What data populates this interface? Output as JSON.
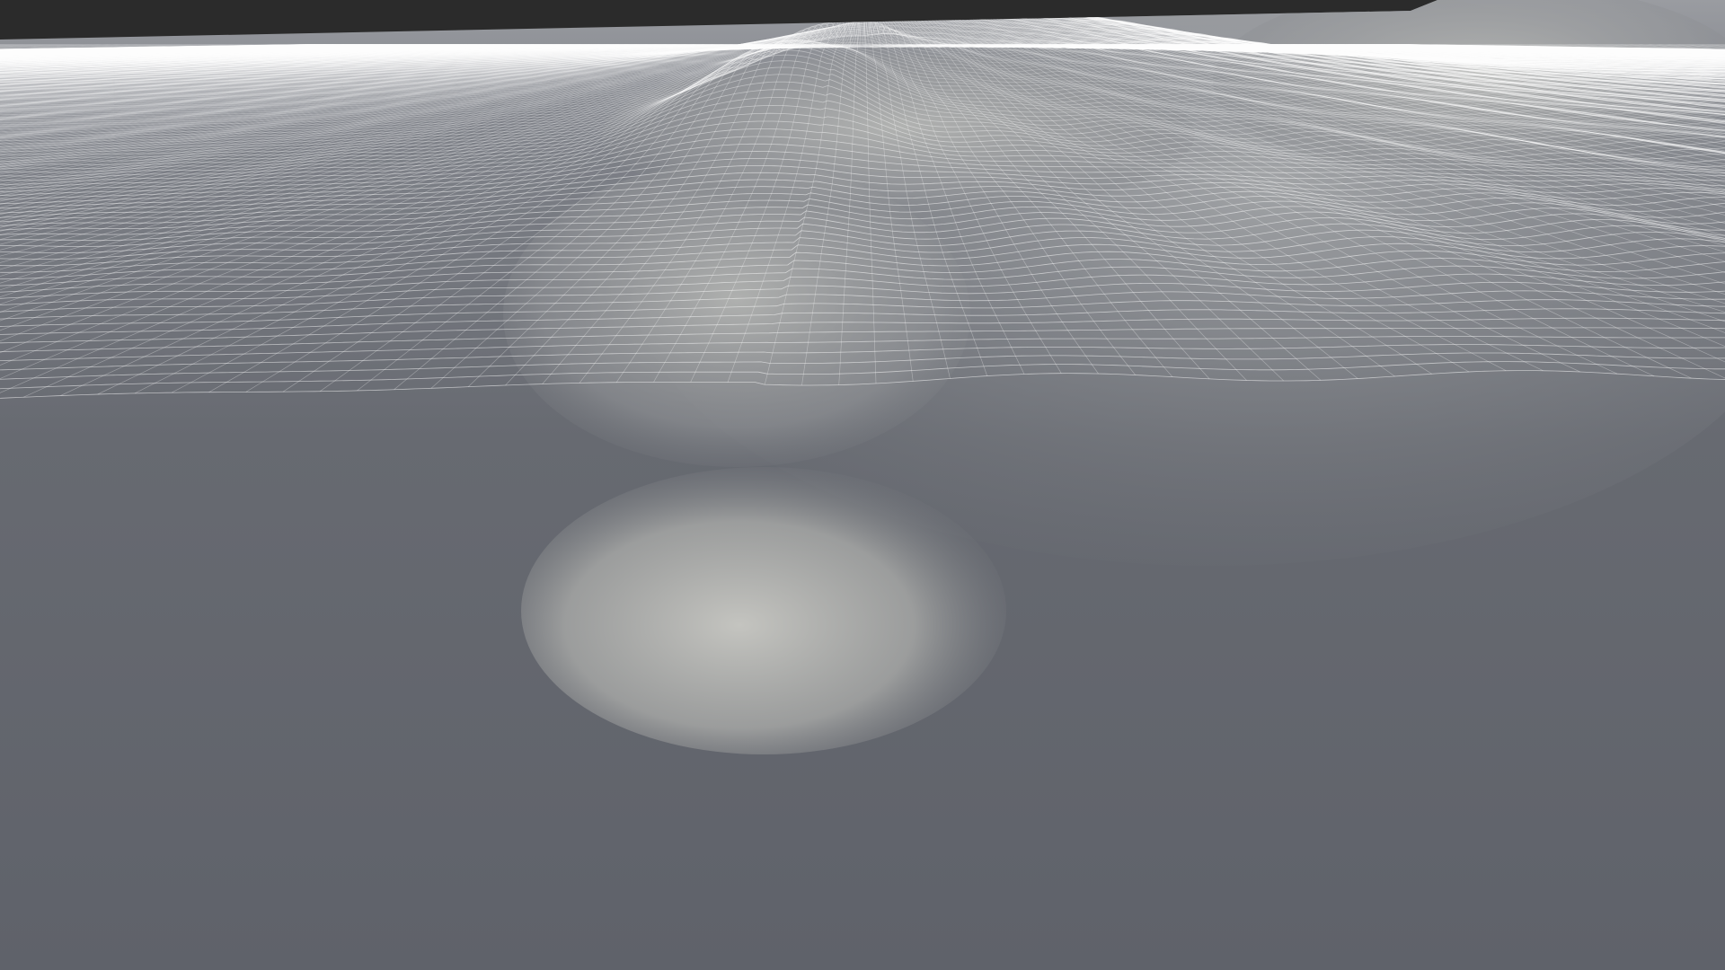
{
  "scene": {
    "kind": "terrain-wireframe",
    "colors": {
      "sky": "#2b2b2b",
      "ground": "#62656c",
      "ground_far": "#8a8d93",
      "wire": "#ffffff",
      "relief_light": "#d9d9d6"
    }
  }
}
